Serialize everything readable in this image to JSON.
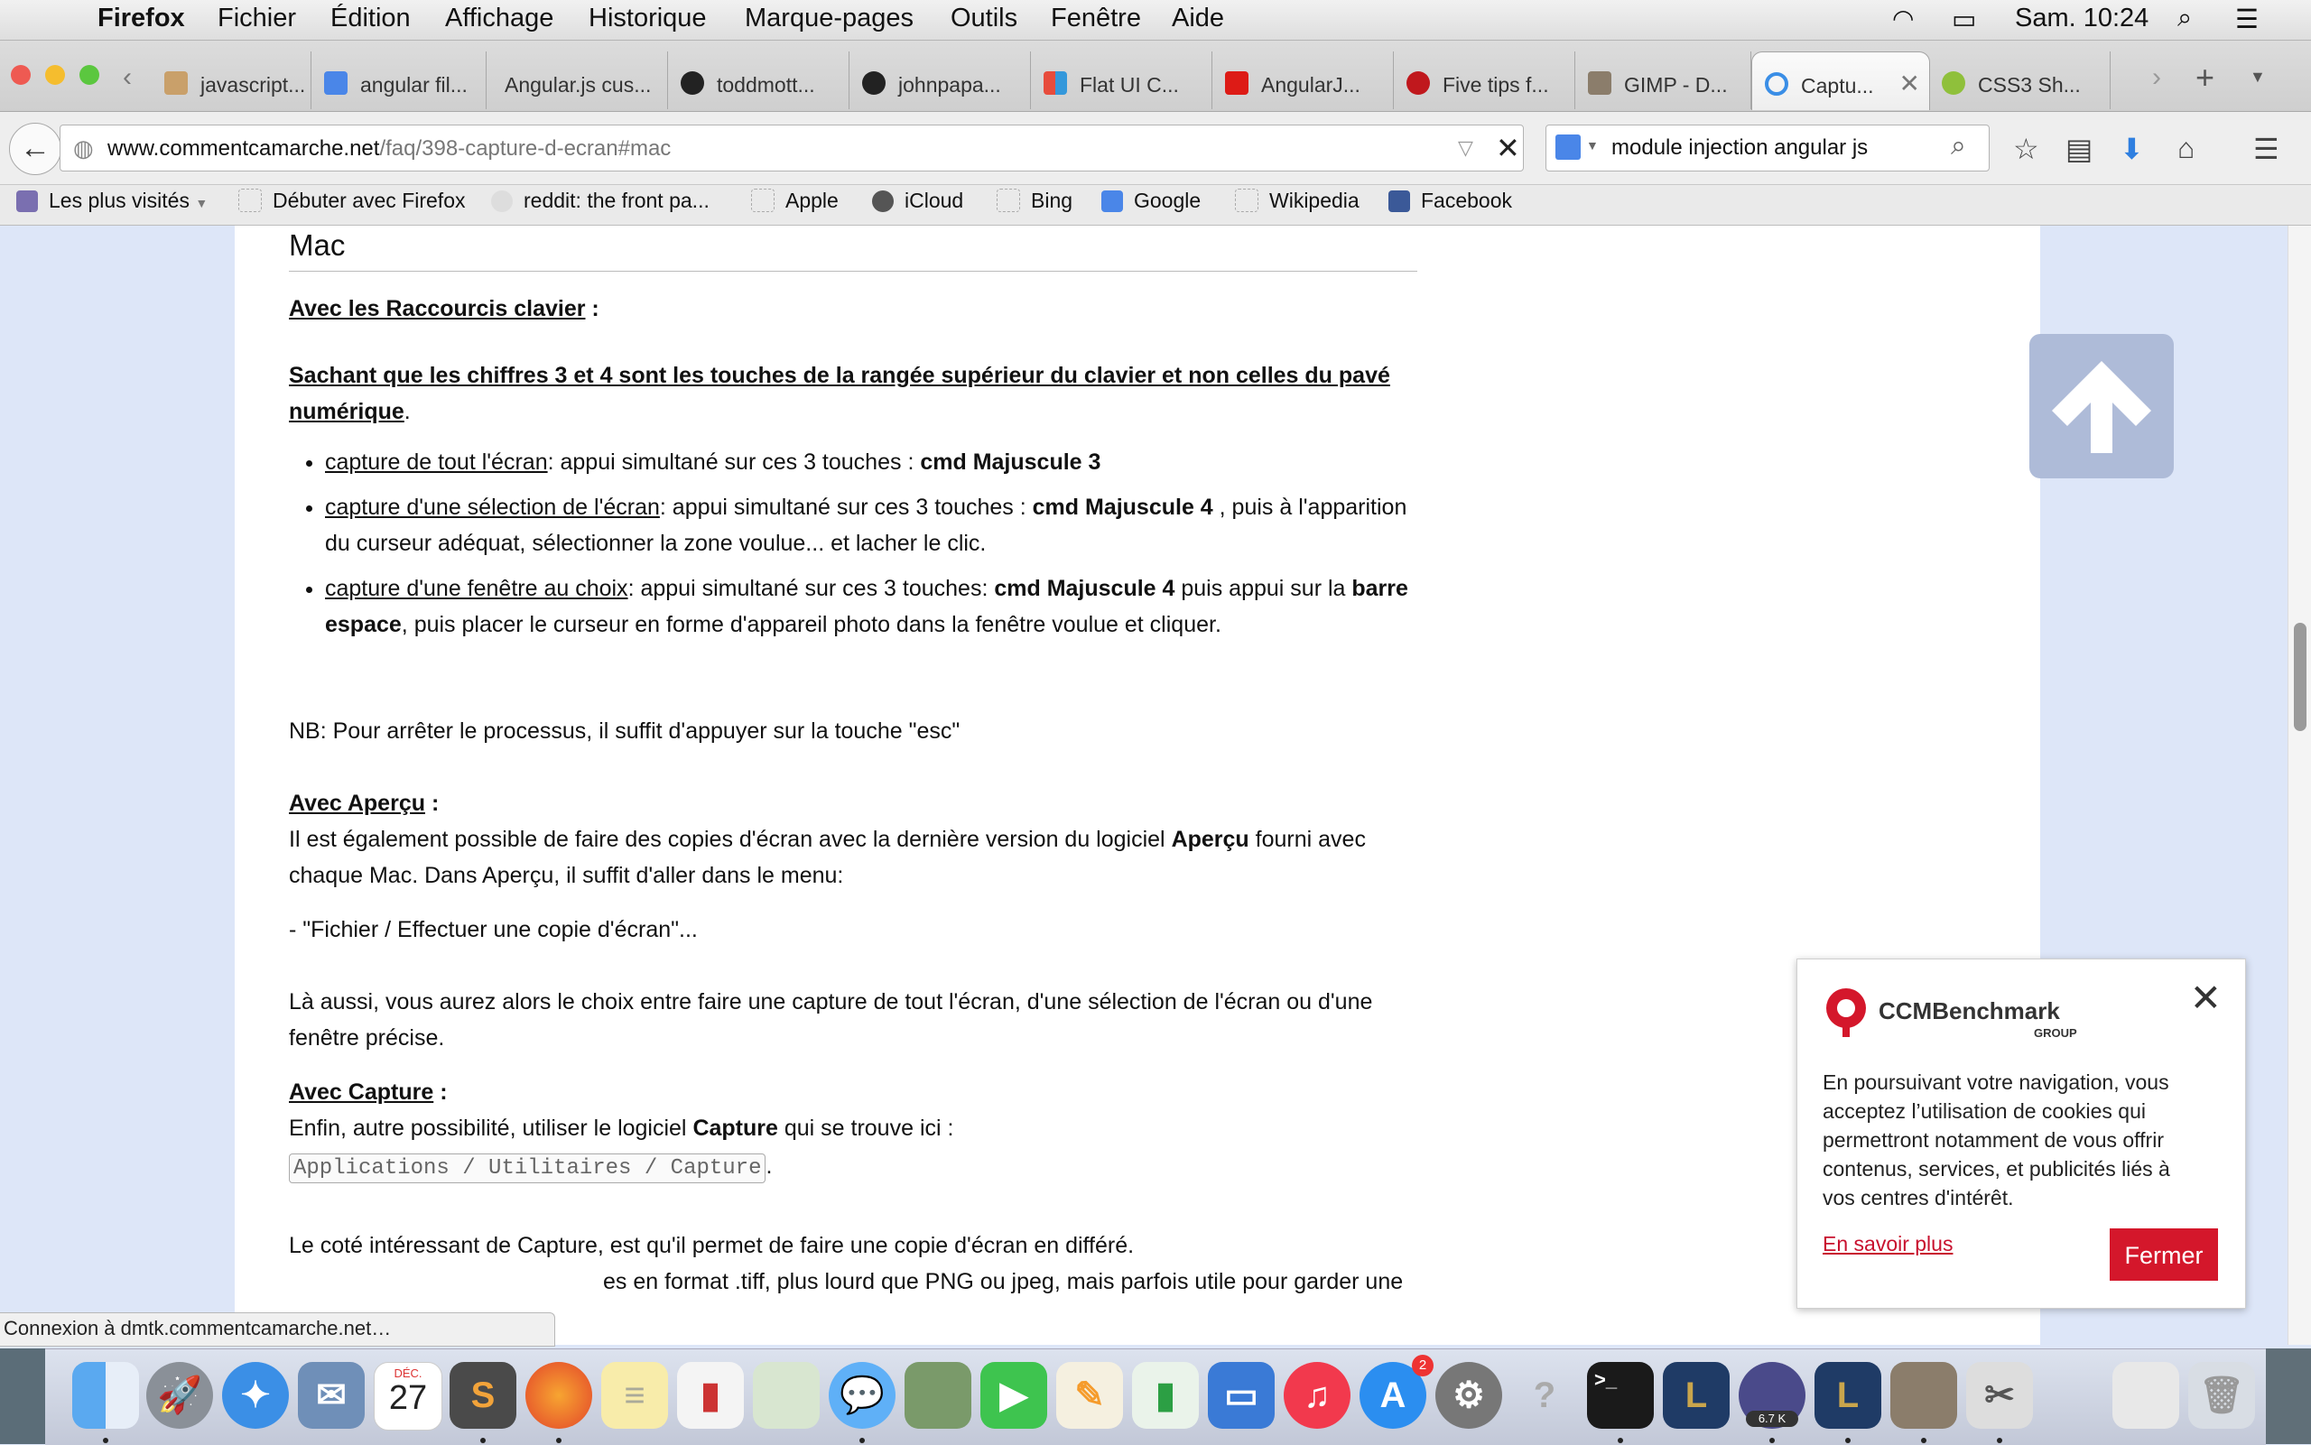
{
  "menubar": {
    "app": "Firefox",
    "items": [
      "Fichier",
      "Édition",
      "Affichage",
      "Historique",
      "Marque-pages",
      "Outils",
      "Fenêtre",
      "Aide"
    ],
    "clock": "Sam. 10:24"
  },
  "tabs": [
    {
      "label": "javascript..."
    },
    {
      "label": "angular fil..."
    },
    {
      "label": "Angular.js cus..."
    },
    {
      "label": "toddmott..."
    },
    {
      "label": "johnpapa..."
    },
    {
      "label": "Flat UI C..."
    },
    {
      "label": "AngularJ..."
    },
    {
      "label": "Five tips f..."
    },
    {
      "label": "GIMP - D..."
    },
    {
      "label": "Captu..."
    },
    {
      "label": "CSS3 Sh..."
    }
  ],
  "urlbar": {
    "domain": "www.commentcamarche.net",
    "path": "/faq/398-capture-d-ecran#mac"
  },
  "searchbar": {
    "value": "module injection angular js"
  },
  "bookmarks": [
    "Les plus visités",
    "Débuter avec Firefox",
    "reddit: the front pa...",
    "Apple",
    "iCloud",
    "Bing",
    "Google",
    "Wikipedia",
    "Facebook"
  ],
  "article": {
    "heading": "Mac",
    "shortcuts_title": "Avec les Raccourcis clavier",
    "colon": " :",
    "note": "Sachant que les chiffres 3 et 4 sont les touches de la rangée supérieur du clavier et non celles du pavé numérique",
    "period": ".",
    "bullets": [
      {
        "link": "capture de tout l'écran",
        "text": ": appui simultané sur ces 3 touches : ",
        "bold": "cmd Majuscule 3",
        "rest": ""
      },
      {
        "link": "capture d'une sélection de l'écran",
        "text": ": appui simultané sur ces 3 touches : ",
        "bold": "cmd Majuscule 4",
        "rest": " , puis à l'apparition du curseur adéquat, sélectionner la zone voulue... et lacher le clic."
      },
      {
        "link": "capture d'une fenêtre au choix",
        "text": ": appui simultané sur ces 3 touches: ",
        "bold": "cmd Majuscule 4",
        "rest": " puis appui sur la ",
        "bold2": "barre espace",
        "rest2": ", puis placer le curseur en forme d'appareil photo dans la fenêtre voulue et cliquer."
      }
    ],
    "nb": "NB: Pour arrêter le processus, il suffit d'appuyer sur la touche \"esc\"",
    "apercu_title": "Avec Aperçu",
    "apercu_p1a": "Il est également possible de faire des copies d'écran avec la dernière version du logiciel ",
    "apercu_bold": "Aperçu",
    "apercu_p1b": " fourni avec chaque Mac. Dans Aperçu, il suffit d'aller dans le menu:",
    "apercu_menu": "- \"Fichier / Effectuer une copie d'écran\"...",
    "apercu_p2": "Là aussi, vous aurez alors le choix entre faire une capture de tout l'écran, d'une sélection de l'écran ou d'une fenêtre précise.",
    "capture_title": "Avec Capture",
    "capture_p1": "Enfin, autre possibilité, utiliser le logiciel ",
    "capture_bold": "Capture",
    "capture_p1b": " qui se trouve ici :",
    "capture_path": "Applications / Utilitaires / Capture",
    "capture_p2": "Le coté intéressant de Capture, est qu'il permet de faire une copie d'écran en différé.",
    "capture_p3": "es en format .tiff, plus lourd que PNG ou jpeg, mais parfois utile pour garder une"
  },
  "cookie": {
    "brand": "CCMBenchmark",
    "brand_sub": "GROUP",
    "text": "En poursuivant votre navigation, vous acceptez l’utilisation de cookies qui permettront notamment de vous offrir contenus, services, et publicités liés à vos centres d'intérêt.",
    "more": "En savoir plus",
    "close_btn": "Fermer"
  },
  "status": "Connexion à dmtk.commentcamarche.net…",
  "dock": {
    "calendar_month": "DÉC.",
    "calendar_day": "27",
    "appstore_badge": "2",
    "download_badge": "6.7 K"
  }
}
